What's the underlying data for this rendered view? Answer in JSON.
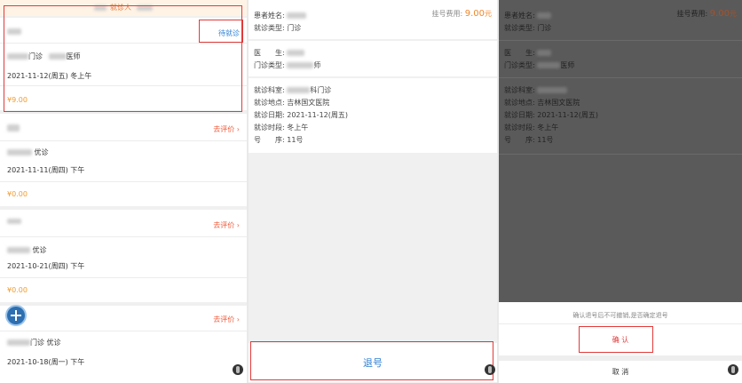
{
  "list": {
    "top_label": "就诊人",
    "cards": [
      {
        "status": "待就诊",
        "dept_type": "门诊",
        "doctor_title": "医师",
        "date": "2021-11-12(周五) 冬上午",
        "price": "¥9.00"
      },
      {
        "status": "去评价",
        "dept_type": "优诊",
        "date": "2021-11-11(周四) 下午",
        "price": "¥0.00"
      },
      {
        "status": "去评价",
        "dept_type": "优诊",
        "date": "2021-10-21(周四) 下午",
        "price": "¥0.00"
      },
      {
        "status": "去评价",
        "dept_type": "门诊 优诊",
        "date": "2021-10-18(周一) 下午"
      }
    ]
  },
  "detail": {
    "patient_label": "患者姓名:",
    "visit_type_label": "就诊类型:",
    "visit_type": "门诊",
    "fee_label": "挂号费用:",
    "fee": "9.00",
    "fee_unit": "元",
    "doctor_label": "医　　生:",
    "clinic_type_label": "门诊类型:",
    "clinic_type_suffix": "师",
    "dept_label": "就诊科室:",
    "dept_suffix": "科门诊",
    "location_label": "就诊地点:",
    "location": "吉林国文医院",
    "date_label": "就诊日期:",
    "date": "2021-11-12(周五)",
    "period_label": "就诊时段:",
    "period": "冬上午",
    "number_label": "号　　序:",
    "number": "11号",
    "cancel_button": "退号"
  },
  "dialog": {
    "clinic_type_suffix": "医师",
    "message": "确认退号后不可撤销,是否确定退号",
    "confirm": "确 认",
    "cancel": "取 消"
  },
  "colors": {
    "highlight": "#e23a3a",
    "accent_blue": "#2d7fd3",
    "price_orange": "#f39a2b"
  }
}
